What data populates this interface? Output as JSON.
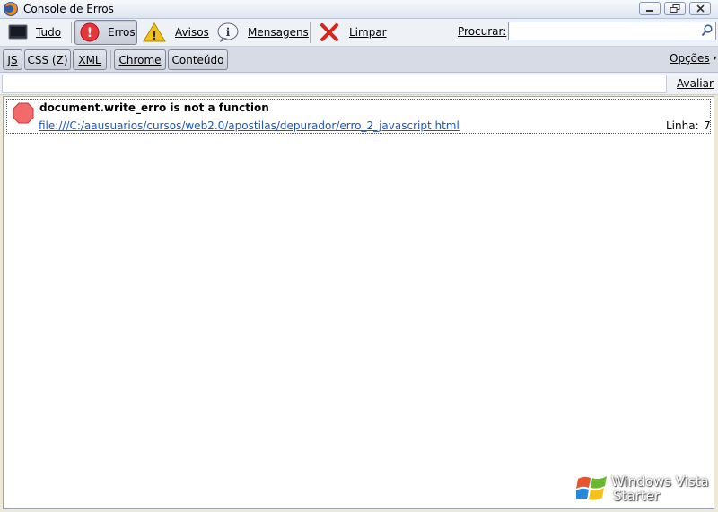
{
  "window": {
    "title": "Console de Erros",
    "buttons": [
      "minimize-icon",
      "restore-icon",
      "close-icon"
    ]
  },
  "toolbar": {
    "all_label": "Tudo",
    "errors_label": "Erros",
    "warnings_label": "Avisos",
    "messages_label": "Mensagens",
    "clear_label": "Limpar",
    "search_label": "Procurar:",
    "search_value": "",
    "active_filter": "Erros"
  },
  "filters": {
    "js_label": "JS",
    "css_label": "CSS (Z)",
    "xml_label": "XML",
    "chrome_label": "Chrome",
    "content_label": "Conteúdo",
    "options_label": "Opções"
  },
  "evaluate": {
    "value": "",
    "button_label": "Avaliar"
  },
  "entries": [
    {
      "type": "error",
      "message": "document.write_erro is not a function",
      "file": "file:///C:/aausuarios/cursos/web2.0/apostilas/depurador/erro_2_javascript.html",
      "line_label": "Linha:",
      "line": "7"
    }
  ],
  "watermark": {
    "line1": "Windows Vista",
    "line2": "Starter"
  },
  "colors": {
    "accent": "#1a56c4",
    "error": "#e8353a",
    "warning": "#f2c21a"
  }
}
